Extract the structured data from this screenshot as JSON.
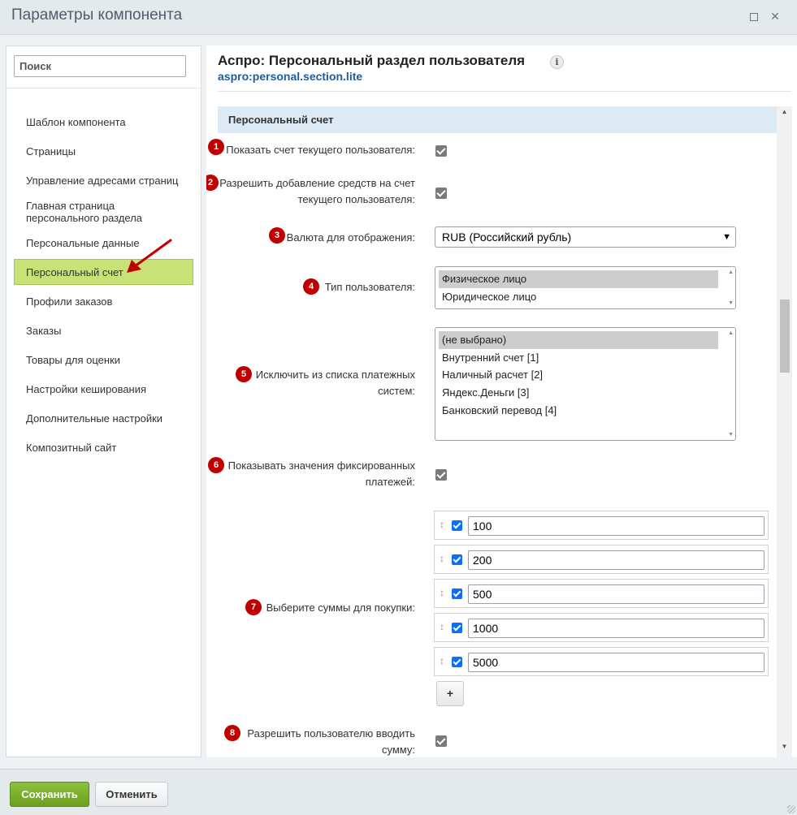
{
  "window": {
    "title": "Параметры компонента",
    "maximize_icon": "maximize-icon",
    "close_icon": "close-icon",
    "close_glyph": "✕"
  },
  "sidebar": {
    "search_placeholder": "Поиск",
    "items": [
      {
        "label": "Шаблон компонента",
        "active": false
      },
      {
        "label": "Страницы",
        "active": false
      },
      {
        "label": "Управление адресами страниц",
        "active": false
      },
      {
        "label": "Главная страница персонального раздела",
        "active": false
      },
      {
        "label": "Персональные данные",
        "active": false
      },
      {
        "label": "Персональный счет",
        "active": true
      },
      {
        "label": "Профили заказов",
        "active": false
      },
      {
        "label": "Заказы",
        "active": false
      },
      {
        "label": "Товары для оценки",
        "active": false
      },
      {
        "label": "Настройки кеширования",
        "active": false
      },
      {
        "label": "Дополнительные настройки",
        "active": false
      },
      {
        "label": "Композитный сайт",
        "active": false
      }
    ]
  },
  "component": {
    "title": "Аспро: Персональный раздел пользователя",
    "code": "aspro:personal.section.lite",
    "info_glyph": "i"
  },
  "section": {
    "title": "Персональный счет"
  },
  "params": {
    "p1": {
      "badge": "1",
      "label": "Показать счет текущего пользователя:",
      "checked": true
    },
    "p2": {
      "badge": "2",
      "label_line1": "Разрешить добавление средств на счет",
      "label_line2": "текущего пользователя:",
      "checked": true
    },
    "p3": {
      "badge": "3",
      "label": "Валюта для отображения:",
      "value": "RUB (Российский рубль)"
    },
    "p4": {
      "badge": "4",
      "label": "Тип пользователя:",
      "options": [
        "Физическое лицо",
        "Юридическое лицо"
      ],
      "selected": "Физическое лицо"
    },
    "p5": {
      "badge": "5",
      "label_line1": "Исключить из списка платежных",
      "label_line2": "систем:",
      "options": [
        "(не выбрано)",
        "Внутренний счет [1]",
        "Наличный расчет [2]",
        "Яндекс.Деньги [3]",
        "Банковский перевод [4]"
      ],
      "selected": "(не выбрано)"
    },
    "p6": {
      "badge": "6",
      "label_line1": "Показывать значения фиксированных",
      "label_line2": "платежей:",
      "checked": true
    },
    "p7": {
      "badge": "7",
      "label": "Выберите суммы для покупки:",
      "amounts": [
        "100",
        "200",
        "500",
        "1000",
        "5000"
      ],
      "add_label": "+"
    },
    "p8": {
      "badge": "8",
      "label_line1": "Разрешить пользователю вводить",
      "label_line2": "сумму:",
      "checked": true
    }
  },
  "footer": {
    "save_label": "Сохранить",
    "cancel_label": "Отменить"
  },
  "colors": {
    "active_item_bg": "#c9e277",
    "badge_red": "#c00000",
    "link_blue": "#1e5d9b",
    "save_green": "#7ab12c",
    "section_bg": "#dde9f5"
  }
}
